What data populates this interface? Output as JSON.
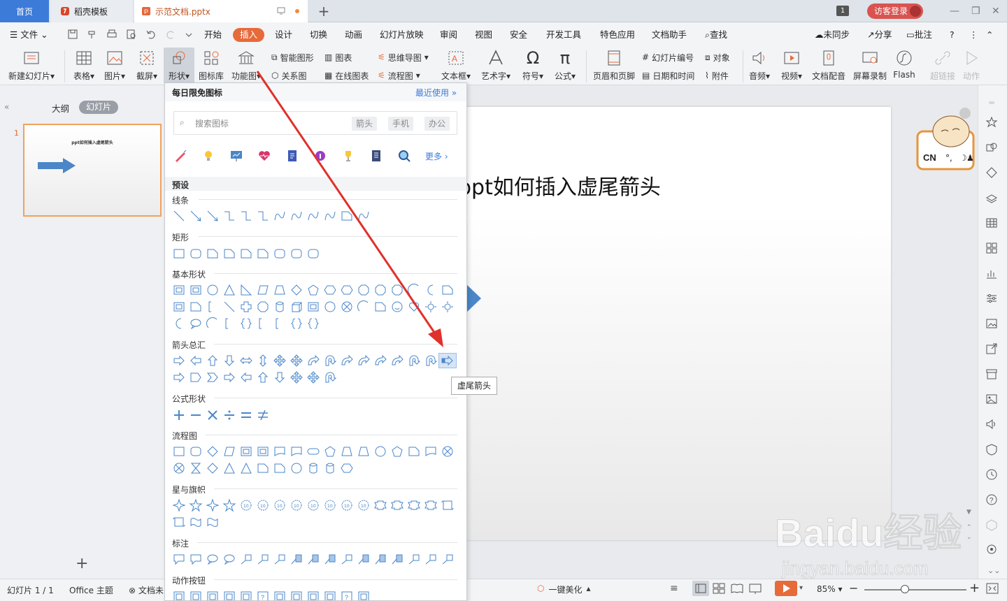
{
  "tabs": {
    "home": "首页",
    "docer": "稻壳模板",
    "file": "示范文档.pptx",
    "count": "1",
    "login": "访客登录"
  },
  "menu": {
    "file": "文件",
    "items": [
      "开始",
      "插入",
      "设计",
      "切换",
      "动画",
      "幻灯片放映",
      "审阅",
      "视图",
      "安全",
      "开发工具",
      "特色应用",
      "文档助手"
    ],
    "search": "查找",
    "sync": "未同步",
    "share": "分享",
    "comment": "批注"
  },
  "ribbon": {
    "new_slide": "新建幻灯片",
    "table": "表格",
    "picture": "图片",
    "screenshot": "截屏",
    "shape": "形状",
    "icon_lib": "图标库",
    "func_chart": "功能图",
    "smart_shape": "智能图形",
    "chart": "图表",
    "mind_map": "思维导图",
    "relation": "关系图",
    "online_chart": "在线图表",
    "flowchart": "流程图",
    "textbox": "文本框",
    "wordart": "艺术字",
    "symbol": "符号",
    "formula": "公式",
    "header_footer": "页眉和页脚",
    "slide_number": "幻灯片编号",
    "object": "对象",
    "datetime": "日期和时间",
    "attachment": "附件",
    "audio": "音频",
    "video": "视频",
    "doc_voice": "文档配音",
    "screen_record": "屏幕录制",
    "flash": "Flash",
    "hyperlink": "超链接",
    "action": "动作"
  },
  "left": {
    "outline": "大纲",
    "slides": "幻灯片",
    "slide_num": "1",
    "thumb_title": "ppt如何插入虚尾箭头"
  },
  "slide": {
    "title": "ppt如何插入虚尾箭头"
  },
  "panel": {
    "header": "每日限免图标",
    "recent": "最近使用",
    "search_placeholder": "搜索图标",
    "tags": [
      "箭头",
      "手机",
      "办公"
    ],
    "more": "更多",
    "sections": {
      "preset": "预设",
      "lines": "线条",
      "rect": "矩形",
      "basic": "基本形状",
      "arrows": "箭头总汇",
      "formula": "公式形状",
      "flow": "流程图",
      "stars": "星与旗帜",
      "callouts": "标注",
      "action": "动作按钮"
    }
  },
  "tooltip": "虚尾箭头",
  "mascot": {
    "label": "CN"
  },
  "status": {
    "slide_pos": "幻灯片 1 / 1",
    "theme": "Office 主题",
    "doc": "文档未",
    "beautify": "一键美化",
    "zoom": "85%"
  },
  "watermark": {
    "brand": "Baidu经验",
    "url": "jingyan.baidu.com"
  },
  "colors": {
    "accent": "#e76a3a",
    "tab_blue": "#3d7bd9",
    "arrow_red": "#e0312a",
    "slide_arrow": "#4a86c8"
  }
}
